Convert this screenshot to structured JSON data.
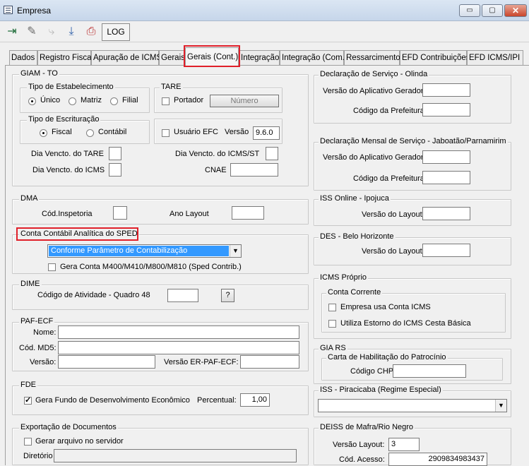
{
  "window": {
    "title": "Empresa",
    "min": "▭",
    "max": "▢",
    "close": "✕"
  },
  "toolbar": {
    "log_label": "LOG"
  },
  "tabs": [
    "Dados",
    "Registro Fiscal",
    "Apuração de ICMS",
    "Gerais",
    "Gerais (Cont.)",
    "Integração",
    "Integração (Com.)",
    "Ressarcimento",
    "EFD Contribuições",
    "EFD ICMS/IPI"
  ],
  "giam": {
    "title": "GIAM - TO",
    "tipo_estab": "Tipo de Estabelecimento",
    "unico": "Único",
    "matriz": "Matriz",
    "filial": "Filial",
    "tare": "TARE",
    "portador": "Portador",
    "numero": "Número",
    "tipo_escrit": "Tipo de Escrituração",
    "fiscal": "Fiscal",
    "contabil": "Contábil",
    "usuario_efc": "Usuário EFC",
    "versao": "Versão",
    "versao_val": "9.6.0",
    "dia_tare": "Dia Vencto. do TARE",
    "dia_icms_st": "Dia Vencto. do ICMS/ST",
    "dia_icms": "Dia Vencto. do ICMS",
    "cnae": "CNAE"
  },
  "dma": {
    "title": "DMA",
    "cod_insp": "Cód.Inspetoria",
    "ano_layout": "Ano Layout"
  },
  "sped": {
    "title": "Conta Contábil Analítica do SPED",
    "selected": "Conforme Parâmetro de Contabilização",
    "gera": "Gera Conta M400/M410/M800/M810 (Sped Contrib.)"
  },
  "dime": {
    "title": "DIME",
    "cod": "Código de Atividade - Quadro 48",
    "help": "?"
  },
  "paf": {
    "title": "PAF-ECF",
    "nome": "Nome:",
    "md5": "Cód. MD5:",
    "versao": "Versão:",
    "versao_er": "Versão ER-PAF-ECF:"
  },
  "fde": {
    "title": "FDE",
    "gera": "Gera Fundo de Desenvolvimento Econômico",
    "percentual": "Percentual:",
    "perc_val": "1,00"
  },
  "export": {
    "title": "Exportação de Documentos",
    "gerar": "Gerar arquivo no servidor",
    "diretorio": "Diretório"
  },
  "olinda": {
    "title": "Declaração de Serviço - Olinda",
    "versao": "Versão do Aplicativo Gerador",
    "codigo": "Código da Prefeitura"
  },
  "jaboatao": {
    "title": "Declaração Mensal de Serviço - Jaboatão/Parnamirim",
    "versao": "Versão do Aplicativo Gerador",
    "codigo": "Código da Prefeitura"
  },
  "iss_ipojuca": {
    "title": "ISS Online - Ipojuca",
    "versao": "Versão do Layout"
  },
  "des_bh": {
    "title": "DES - Belo Horizonte",
    "versao": "Versão do Layout"
  },
  "icms_proprio": {
    "title": "ICMS Próprio",
    "conta": "Conta Corrente",
    "empresa": "Empresa usa Conta ICMS",
    "estorno": "Utiliza Estorno do ICMS Cesta Básica"
  },
  "gia_rs": {
    "title": "GIA RS",
    "carta": "Carta de Habilitação do Patrocínio",
    "codigo": "Código CHP"
  },
  "iss_pira": {
    "title": "ISS - Piracicaba (Regime Especial)"
  },
  "deiss": {
    "title": "DEISS de Mafra/Rio Negro",
    "versao": "Versão Layout:",
    "versao_val": "3",
    "cod": "Cód. Acesso:",
    "cod_val": "2909834983437"
  }
}
